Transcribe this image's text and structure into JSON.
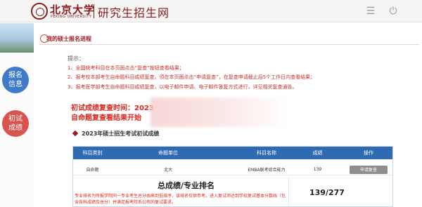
{
  "header": {
    "logo_cn": "北京大学",
    "logo_en": "PEKING UNIVERSITY",
    "site_name": "研究生招生网"
  },
  "sidebar": {
    "info_label": "报名\n信息",
    "prelim_label": "初试\n成绩"
  },
  "main": {
    "section_title": "我的硕士报名进程",
    "tips_label": "提示：",
    "tips": [
      "1、全国统考科目在本页面点击“复查”按钮查看结果；",
      "2、报考校本部考生自命题科目成绩复查，须在本页面点击“申请复查”，在复查申请截止后5个工作日内查看结果；",
      "3、报考医学部考生自命题科目成绩复查，以电子邮件申请、电子邮件答复方式进行，详见相关复查通告。"
    ],
    "recheck_time": "初试成绩复查时间：2023",
    "recheck_result": "自命题复查看结果开始",
    "results_heading": "2023年硕士招生考试初试成绩"
  },
  "table": {
    "headers": [
      "科目类别",
      "命题单位",
      "科目名称",
      "成绩",
      "操作"
    ],
    "row": {
      "category": "自命题",
      "unit": "北大",
      "subject": "EMBA联考综合能力",
      "score": "139",
      "action": "申请复查"
    },
    "total_label": "总成绩/专业排名",
    "total_note": "专业排名为所报学院同一专业考生总分由高到低排序，该排名仅供参考。进入复试须达到学校复试基本分数线（包含各科成绩及总分）并满足报考院系公布的复试要求。",
    "total_score": "139/277"
  }
}
